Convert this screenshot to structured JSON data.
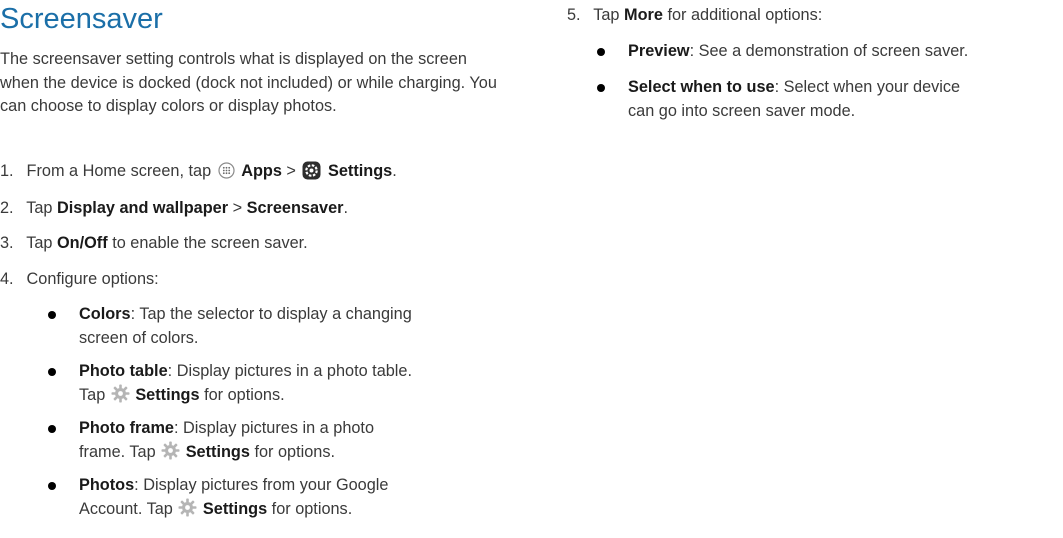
{
  "title": "Screensaver",
  "intro": "The screensaver setting controls what is displayed on the screen when the device is docked (dock not included) or while charging. You can choose to display colors or display photos.",
  "steps": [
    {
      "num": "1.",
      "pre": "From a Home screen, tap",
      "apps": "Apps",
      "sep": ">",
      "settings": "Settings",
      "post": "."
    },
    {
      "num": "2.",
      "pre": "Tap",
      "b1": "Display and wallpaper",
      "sep": ">",
      "b2": "Screensaver",
      "post": "."
    },
    {
      "num": "3.",
      "pre": "Tap",
      "b1": "On/Off",
      "post": "to enable the screen saver."
    },
    {
      "num": "4.",
      "text": "Configure options:"
    },
    {
      "num": "5.",
      "pre": "Tap",
      "b1": "More",
      "post": "for additional options:"
    }
  ],
  "options": [
    {
      "label": "Colors",
      "desc1": ": Tap the selector to display a changing",
      "desc2": "screen of colors."
    },
    {
      "label": "Photo table",
      "desc1": ": Display pictures in a photo table.",
      "tap": "Tap",
      "settings": "Settings",
      "post": "for options."
    },
    {
      "label": "Photo frame",
      "desc1": ": Display pictures in a photo",
      "tap": "frame. Tap",
      "settings": "Settings",
      "post": "for options."
    },
    {
      "label": "Photos",
      "desc1": ": Display pictures from your Google",
      "tap": "Account. Tap",
      "settings": "Settings",
      "post": "for options."
    }
  ],
  "more_options": [
    {
      "label": "Preview",
      "desc1": ": See a demonstration of screen saver."
    },
    {
      "label": "Select when to use",
      "desc1": ": Select when your device",
      "desc2": "can go into screen saver mode."
    }
  ],
  "colors": {
    "heading": "#1b6fa8",
    "text": "#3a3a3a"
  }
}
